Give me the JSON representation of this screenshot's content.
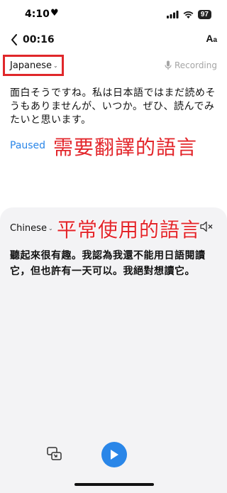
{
  "status_bar": {
    "time": "4:10",
    "heart": "♥",
    "battery": "97"
  },
  "nav": {
    "timer": "00:16",
    "font_size_label_big": "A",
    "font_size_label_small": "a"
  },
  "source": {
    "language": "Japanese",
    "recording_label": "Recording",
    "text": "面白そうですね。私は日本語ではまだ読めそうもありませんが、いつか。ぜひ、読んでみたいと思います。",
    "status": "Paused",
    "annotation": "需要翻譯的語言"
  },
  "target": {
    "language": "Chinese",
    "text": "聽起來很有趣。我認為我還不能用日語閱讀它，但也許有一天可以。我絕對想讀它。",
    "annotation": "平常使用的語言"
  },
  "colors": {
    "accent": "#2a86e8",
    "annotation_red": "#e3262b",
    "panel_bg": "#f3f3f5"
  },
  "icons": {
    "back": "chevron-left-icon",
    "mic": "microphone-icon",
    "speaker": "speaker-muted-icon",
    "pip": "picture-in-picture-icon",
    "play": "play-icon"
  }
}
